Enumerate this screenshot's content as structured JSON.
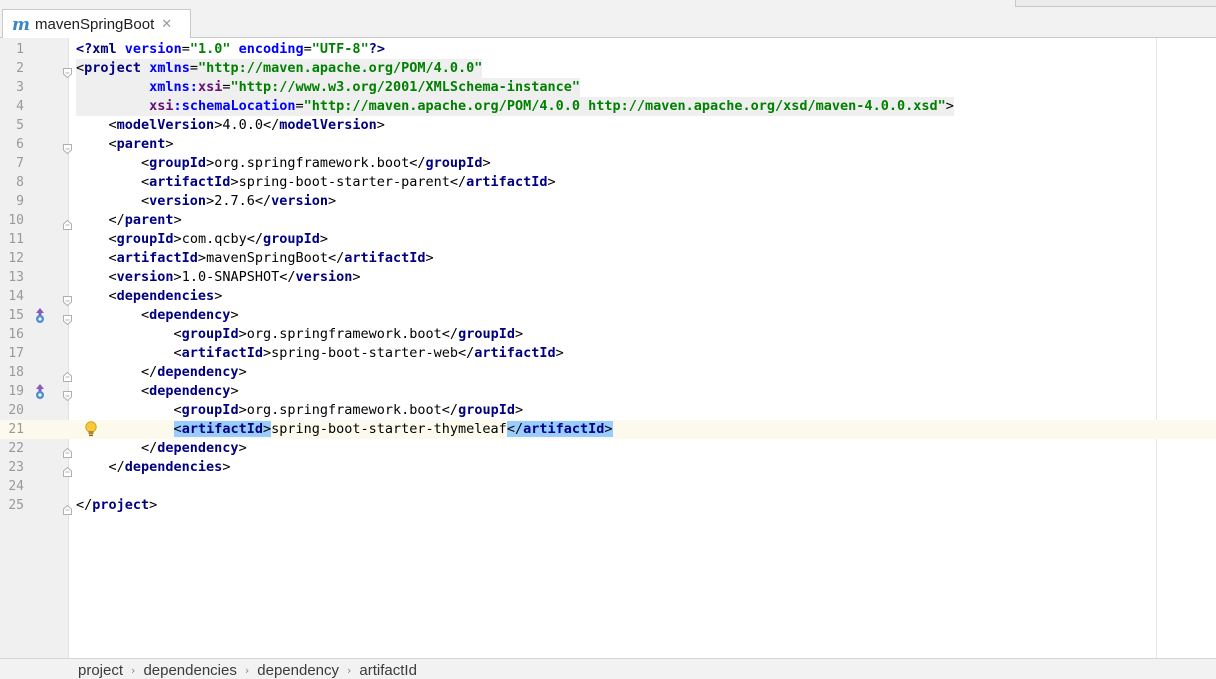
{
  "tab": {
    "icon": "maven-m-icon",
    "title": "mavenSpringBoot",
    "close_glyph": "✕"
  },
  "editor": {
    "caret_line": 21,
    "lines": [
      {
        "n": "1",
        "fold": "none",
        "hl": false,
        "tokens": [
          [
            "pi",
            "<?"
          ],
          [
            "pi",
            "xml"
          ],
          [
            "p",
            " "
          ],
          [
            "a",
            "version"
          ],
          [
            "p",
            "="
          ],
          [
            "s",
            "\"1.0\""
          ],
          [
            "p",
            " "
          ],
          [
            "a",
            "encoding"
          ],
          [
            "p",
            "="
          ],
          [
            "s",
            "\"UTF-8\""
          ],
          [
            "pi",
            "?>"
          ]
        ]
      },
      {
        "n": "2",
        "fold": "open",
        "hl": true,
        "tokens": [
          [
            "p",
            "<"
          ],
          [
            "t",
            "project"
          ],
          [
            "p",
            " "
          ],
          [
            "a",
            "xmlns"
          ],
          [
            "p",
            "="
          ],
          [
            "s",
            "\"http://maven.apache.org/POM/4.0.0\""
          ]
        ]
      },
      {
        "n": "3",
        "fold": "none",
        "hl": true,
        "tokens": [
          [
            "p",
            "         "
          ],
          [
            "a",
            "xmlns"
          ],
          [
            "a",
            ":"
          ],
          [
            "ns",
            "xsi"
          ],
          [
            "p",
            "="
          ],
          [
            "s",
            "\"http://www.w3.org/2001/XMLSchema-instance\""
          ]
        ]
      },
      {
        "n": "4",
        "fold": "none",
        "hl": true,
        "tokens": [
          [
            "p",
            "         "
          ],
          [
            "ns",
            "xsi"
          ],
          [
            "a",
            ":"
          ],
          [
            "a",
            "schemaLocation"
          ],
          [
            "p",
            "="
          ],
          [
            "s",
            "\"http://maven.apache.org/POM/4.0.0 http://maven.apache.org/xsd/maven-4.0.0.xsd\""
          ],
          [
            "p",
            ">"
          ]
        ]
      },
      {
        "n": "5",
        "fold": "none",
        "hl": false,
        "tokens": [
          [
            "p",
            "    <"
          ],
          [
            "t",
            "modelVersion"
          ],
          [
            "p",
            ">"
          ],
          [
            "tx",
            "4.0.0"
          ],
          [
            "p",
            "</"
          ],
          [
            "t",
            "modelVersion"
          ],
          [
            "p",
            ">"
          ]
        ]
      },
      {
        "n": "6",
        "fold": "open",
        "hl": false,
        "tokens": [
          [
            "p",
            "    <"
          ],
          [
            "t",
            "parent"
          ],
          [
            "p",
            ">"
          ]
        ]
      },
      {
        "n": "7",
        "fold": "none",
        "hl": false,
        "tokens": [
          [
            "p",
            "        <"
          ],
          [
            "t",
            "groupId"
          ],
          [
            "p",
            ">"
          ],
          [
            "tx",
            "org.springframework.boot"
          ],
          [
            "p",
            "</"
          ],
          [
            "t",
            "groupId"
          ],
          [
            "p",
            ">"
          ]
        ]
      },
      {
        "n": "8",
        "fold": "none",
        "hl": false,
        "tokens": [
          [
            "p",
            "        <"
          ],
          [
            "t",
            "artifactId"
          ],
          [
            "p",
            ">"
          ],
          [
            "tx",
            "spring-boot-starter-parent"
          ],
          [
            "p",
            "</"
          ],
          [
            "t",
            "artifactId"
          ],
          [
            "p",
            ">"
          ]
        ]
      },
      {
        "n": "9",
        "fold": "none",
        "hl": false,
        "tokens": [
          [
            "p",
            "        <"
          ],
          [
            "t",
            "version"
          ],
          [
            "p",
            ">"
          ],
          [
            "tx",
            "2.7.6"
          ],
          [
            "p",
            "</"
          ],
          [
            "t",
            "version"
          ],
          [
            "p",
            ">"
          ]
        ]
      },
      {
        "n": "10",
        "fold": "close",
        "hl": false,
        "tokens": [
          [
            "p",
            "    </"
          ],
          [
            "t",
            "parent"
          ],
          [
            "p",
            ">"
          ]
        ]
      },
      {
        "n": "11",
        "fold": "none",
        "hl": false,
        "tokens": [
          [
            "p",
            "    <"
          ],
          [
            "t",
            "groupId"
          ],
          [
            "p",
            ">"
          ],
          [
            "tx",
            "com.qcby"
          ],
          [
            "p",
            "</"
          ],
          [
            "t",
            "groupId"
          ],
          [
            "p",
            ">"
          ]
        ]
      },
      {
        "n": "12",
        "fold": "none",
        "hl": false,
        "tokens": [
          [
            "p",
            "    <"
          ],
          [
            "t",
            "artifactId"
          ],
          [
            "p",
            ">"
          ],
          [
            "tx",
            "mavenSpringBoot"
          ],
          [
            "p",
            "</"
          ],
          [
            "t",
            "artifactId"
          ],
          [
            "p",
            ">"
          ]
        ]
      },
      {
        "n": "13",
        "fold": "none",
        "hl": false,
        "tokens": [
          [
            "p",
            "    <"
          ],
          [
            "t",
            "version"
          ],
          [
            "p",
            ">"
          ],
          [
            "tx",
            "1.0-SNAPSHOT"
          ],
          [
            "p",
            "</"
          ],
          [
            "t",
            "version"
          ],
          [
            "p",
            ">"
          ]
        ]
      },
      {
        "n": "14",
        "fold": "open",
        "hl": false,
        "tokens": [
          [
            "p",
            "    <"
          ],
          [
            "t",
            "dependencies"
          ],
          [
            "p",
            ">"
          ]
        ]
      },
      {
        "n": "15",
        "fold": "open",
        "hl": false,
        "impl": true,
        "tokens": [
          [
            "p",
            "        <"
          ],
          [
            "t",
            "dependency"
          ],
          [
            "p",
            ">"
          ]
        ]
      },
      {
        "n": "16",
        "fold": "none",
        "hl": false,
        "tokens": [
          [
            "p",
            "            <"
          ],
          [
            "t",
            "groupId"
          ],
          [
            "p",
            ">"
          ],
          [
            "tx",
            "org.springframework.boot"
          ],
          [
            "p",
            "</"
          ],
          [
            "t",
            "groupId"
          ],
          [
            "p",
            ">"
          ]
        ]
      },
      {
        "n": "17",
        "fold": "none",
        "hl": false,
        "tokens": [
          [
            "p",
            "            <"
          ],
          [
            "t",
            "artifactId"
          ],
          [
            "p",
            ">"
          ],
          [
            "tx",
            "spring-boot-starter-web"
          ],
          [
            "p",
            "</"
          ],
          [
            "t",
            "artifactId"
          ],
          [
            "p",
            ">"
          ]
        ]
      },
      {
        "n": "18",
        "fold": "close",
        "hl": false,
        "tokens": [
          [
            "p",
            "        </"
          ],
          [
            "t",
            "dependency"
          ],
          [
            "p",
            ">"
          ]
        ]
      },
      {
        "n": "19",
        "fold": "open",
        "hl": false,
        "impl": true,
        "tokens": [
          [
            "p",
            "        <"
          ],
          [
            "t",
            "dependency"
          ],
          [
            "p",
            ">"
          ]
        ]
      },
      {
        "n": "20",
        "fold": "none",
        "hl": false,
        "tokens": [
          [
            "p",
            "            <"
          ],
          [
            "t",
            "groupId"
          ],
          [
            "p",
            ">"
          ],
          [
            "tx",
            "org.springframework.boot"
          ],
          [
            "p",
            "</"
          ],
          [
            "t",
            "groupId"
          ],
          [
            "p",
            ">"
          ]
        ]
      },
      {
        "n": "21",
        "fold": "none",
        "hl": false,
        "bulb": true,
        "tokens": [
          [
            "p",
            "            "
          ],
          [
            "m",
            "<"
          ],
          [
            "mt",
            "artifactId"
          ],
          [
            "m",
            ">"
          ],
          [
            "tx",
            "spring-boot-starter-thymeleaf"
          ],
          [
            "m",
            "</"
          ],
          [
            "mt",
            "artifactId"
          ],
          [
            "m",
            ">"
          ]
        ]
      },
      {
        "n": "22",
        "fold": "close",
        "hl": false,
        "tokens": [
          [
            "p",
            "        </"
          ],
          [
            "t",
            "dependency"
          ],
          [
            "p",
            ">"
          ]
        ]
      },
      {
        "n": "23",
        "fold": "close",
        "hl": false,
        "tokens": [
          [
            "p",
            "    </"
          ],
          [
            "t",
            "dependencies"
          ],
          [
            "p",
            ">"
          ]
        ]
      },
      {
        "n": "24",
        "fold": "none",
        "hl": false,
        "tokens": []
      },
      {
        "n": "25",
        "fold": "close",
        "hl": false,
        "tokens": [
          [
            "p",
            "</"
          ],
          [
            "t",
            "project"
          ],
          [
            "p",
            ">"
          ]
        ]
      }
    ]
  },
  "breadcrumb": [
    "project",
    "dependencies",
    "dependency",
    "artifactId"
  ],
  "colors": {
    "tag": "#000080",
    "attr": "#0000ff",
    "string": "#008000",
    "match_bg": "#99ccff",
    "caret_line_bg": "#fcfaed",
    "gutter_bg": "#f0f0f0"
  }
}
